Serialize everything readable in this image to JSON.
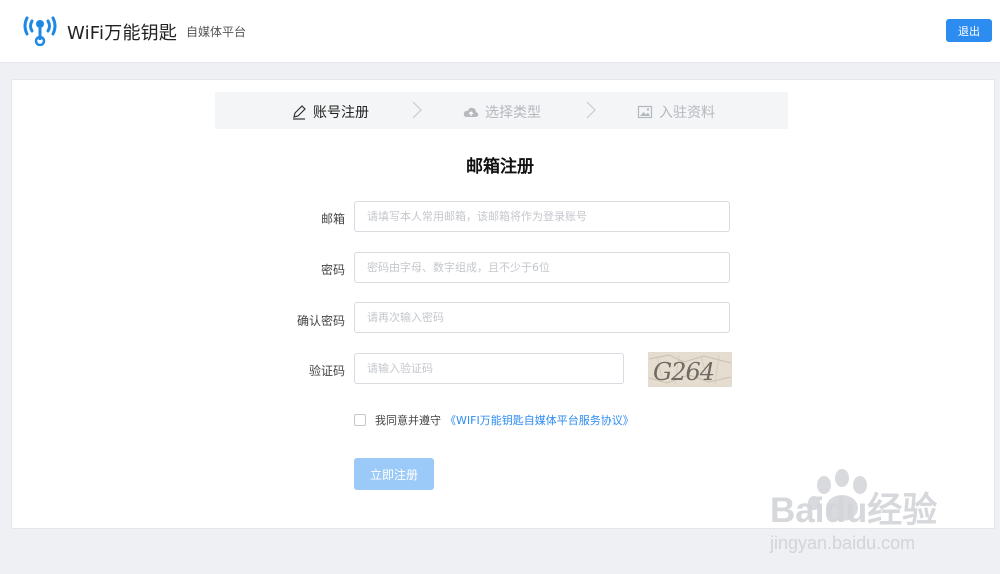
{
  "header": {
    "app_name": "WiFi万能钥匙",
    "app_sub": "自媒体平台",
    "logout_label": "退出"
  },
  "steps": [
    {
      "label": "账号注册",
      "icon": "pencil-icon",
      "active": true
    },
    {
      "label": "选择类型",
      "icon": "cloud-icon",
      "active": false
    },
    {
      "label": "入驻资料",
      "icon": "image-icon",
      "active": false
    }
  ],
  "form": {
    "title": "邮箱注册",
    "email": {
      "label": "邮箱",
      "placeholder": "请填写本人常用邮箱，该邮箱将作为登录账号",
      "value": ""
    },
    "password": {
      "label": "密码",
      "placeholder": "密码由字母、数字组成，且不少于6位",
      "value": ""
    },
    "confirm_password": {
      "label": "确认密码",
      "placeholder": "请再次输入密码",
      "value": ""
    },
    "captcha": {
      "label": "验证码",
      "placeholder": "请输入验证码",
      "value": "",
      "image_text": "G264"
    },
    "agree_text": "我同意并遵守",
    "agree_link": "《WIFI万能钥匙自媒体平台服务协议》",
    "submit_label": "立即注册"
  },
  "watermark": {
    "brand": "Baidu经验",
    "url": "jingyan.baidu.com"
  },
  "colors": {
    "accent": "#2d8cf0",
    "submit_disabled": "#9ccaf8",
    "page_bg": "#eef0f3",
    "steps_bg": "#f3f5f7",
    "inactive_step": "#b5b8bd"
  }
}
